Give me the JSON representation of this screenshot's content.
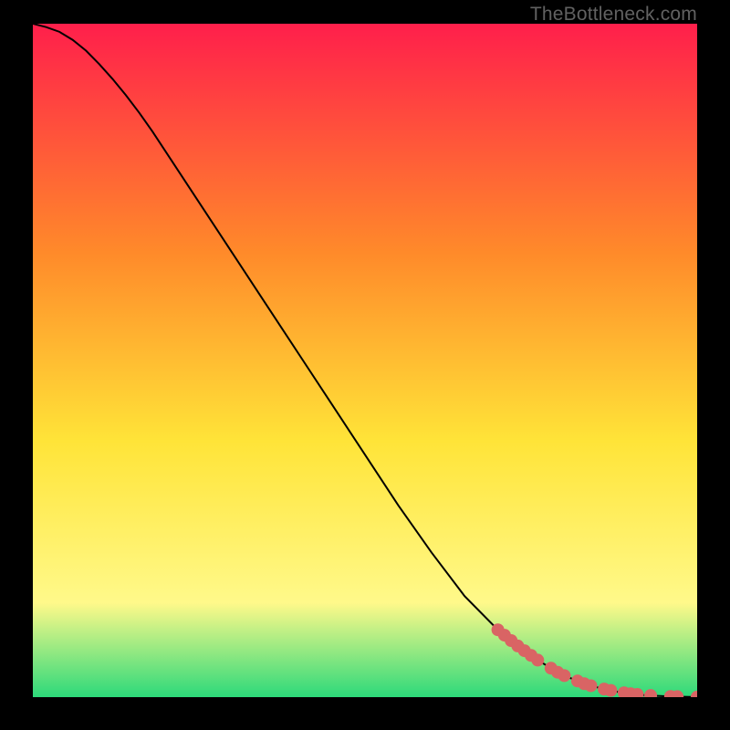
{
  "watermark": "TheBottleneck.com",
  "colors": {
    "bg": "#000000",
    "gradient_top": "#ff1f4b",
    "gradient_mid1": "#ff8a2a",
    "gradient_mid2": "#ffe438",
    "gradient_mid3": "#fff98a",
    "gradient_bottom": "#2dd97a",
    "curve": "#000000",
    "marker": "#d96464"
  },
  "chart_data": {
    "type": "line",
    "title": "",
    "xlabel": "",
    "ylabel": "",
    "xlim": [
      0,
      100
    ],
    "ylim": [
      0,
      100
    ],
    "series": [
      {
        "name": "curve",
        "x": [
          0,
          2,
          4,
          6,
          8,
          10,
          12,
          14,
          16,
          18,
          20,
          25,
          30,
          35,
          40,
          45,
          50,
          55,
          60,
          65,
          70,
          72,
          74,
          76,
          78,
          80,
          82,
          84,
          86,
          88,
          90,
          92,
          94,
          96,
          98,
          100
        ],
        "y": [
          100,
          99.5,
          98.8,
          97.6,
          96.0,
          94.0,
          91.8,
          89.4,
          86.8,
          84.0,
          81.0,
          73.5,
          66.0,
          58.5,
          51.0,
          43.5,
          36.0,
          28.5,
          21.5,
          15.0,
          10.0,
          8.4,
          6.9,
          5.5,
          4.3,
          3.2,
          2.4,
          1.7,
          1.2,
          0.8,
          0.5,
          0.3,
          0.18,
          0.1,
          0.05,
          0.02
        ]
      }
    ],
    "markers": {
      "name": "highlighted-points",
      "x": [
        70,
        71,
        72,
        73,
        74,
        75,
        76,
        78,
        79,
        80,
        82,
        83,
        84,
        86,
        87,
        89,
        90,
        91,
        93,
        96,
        97,
        100
      ],
      "y": [
        10.0,
        9.2,
        8.4,
        7.6,
        6.9,
        6.2,
        5.5,
        4.3,
        3.7,
        3.2,
        2.4,
        2.0,
        1.7,
        1.2,
        1.0,
        0.65,
        0.5,
        0.4,
        0.25,
        0.1,
        0.08,
        0.02
      ]
    }
  }
}
